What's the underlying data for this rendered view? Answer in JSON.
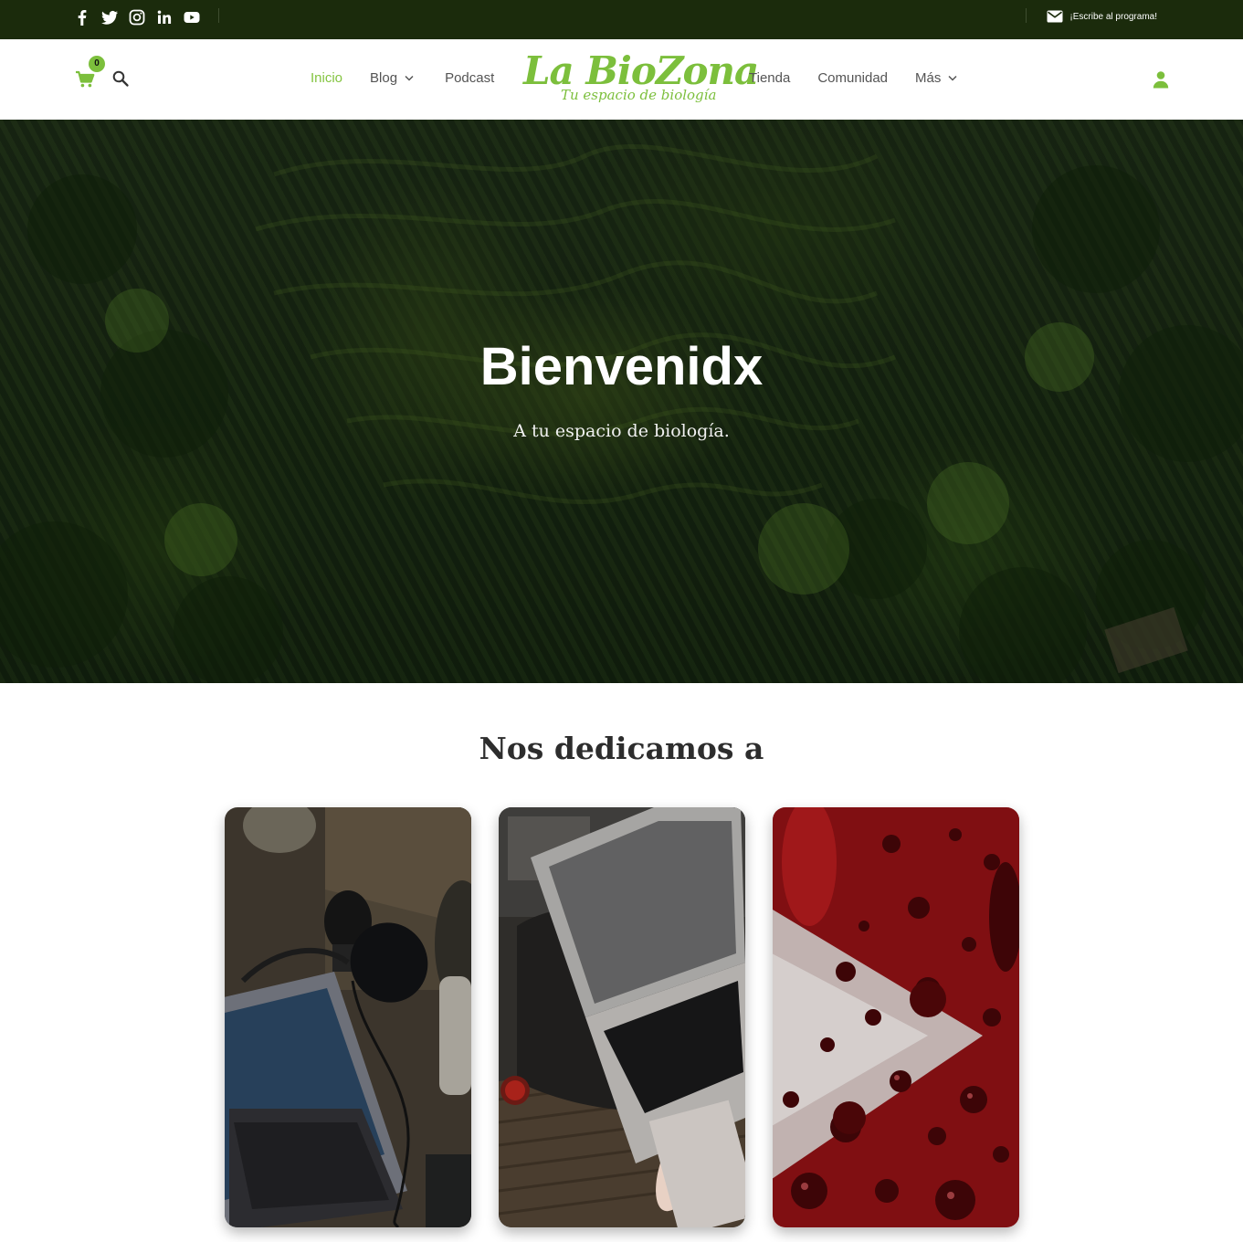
{
  "topbar": {
    "social_icons": [
      "facebook-icon",
      "twitter-icon",
      "instagram-icon",
      "linkedin-icon",
      "youtube-icon"
    ],
    "contact_icon": "envelope-icon",
    "contact_label": "¡Escribe al programa!"
  },
  "header": {
    "cart_icon": "cart-icon",
    "cart_count": "0",
    "search_icon": "search-icon",
    "nav_left": [
      {
        "label": "Inicio",
        "active": true
      },
      {
        "label": "Blog",
        "dropdown": true
      },
      {
        "label": "Podcast"
      }
    ],
    "nav_right": [
      {
        "label": "Tienda"
      },
      {
        "label": "Comunidad"
      },
      {
        "label": "Más",
        "dropdown": true
      }
    ],
    "logo_text": "La BioZona",
    "logo_tagline": "Tu espacio de biología",
    "user_icon": "user-icon"
  },
  "hero": {
    "title": "Bienvenidx",
    "subtitle": "A tu espacio de biología."
  },
  "section": {
    "title": "Nos dedicamos a"
  },
  "cards": [
    {
      "image": "podcast-microphone-laptop-photo"
    },
    {
      "image": "laptop-typing-photo"
    },
    {
      "image": "youtube-logo-water-drops-photo"
    }
  ],
  "colors": {
    "topbar_bg": "#1b2b0c",
    "accent_green": "#7cbf3c",
    "nav_text": "#545454"
  }
}
